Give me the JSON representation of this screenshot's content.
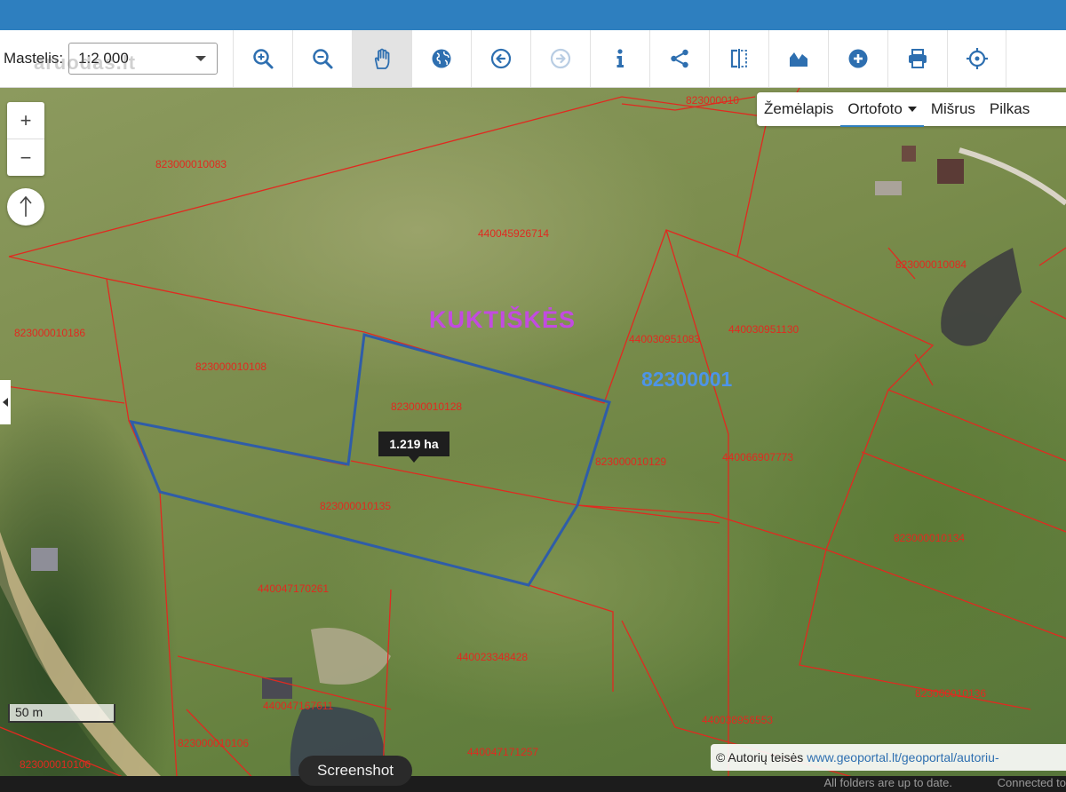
{
  "toolbar": {
    "scale_label": "Mastelis:",
    "scale_value": "1:2 000",
    "watermark": "aruodas.lt",
    "tools": [
      {
        "name": "zoom-in-icon"
      },
      {
        "name": "zoom-out-icon"
      },
      {
        "name": "pan-hand-icon",
        "active": true
      },
      {
        "name": "globe-icon"
      },
      {
        "name": "back-arrow-icon"
      },
      {
        "name": "forward-arrow-icon",
        "disabled": true
      },
      {
        "name": "info-icon"
      },
      {
        "name": "share-icon"
      },
      {
        "name": "split-compare-icon"
      },
      {
        "name": "profile-chart-icon"
      },
      {
        "name": "add-icon"
      },
      {
        "name": "print-icon"
      },
      {
        "name": "locate-icon"
      }
    ]
  },
  "map_controls": {
    "zoom_in": "+",
    "zoom_out": "−",
    "north": "↑"
  },
  "basemap": {
    "options": [
      "Žemėlapis",
      "Ortofoto",
      "Mišrus",
      "Pilkas"
    ],
    "selected": "Ortofoto"
  },
  "map": {
    "place_name": "KUKTIŠKĖS",
    "cadastral_area_code": "82300001",
    "selected_area": "1.219 ha",
    "scale_bar": "50 m",
    "parcels": [
      "823000010083",
      "440045926714",
      "823000010084",
      "823000010186",
      "823000010108",
      "440030951083",
      "440030951130",
      "823000010128",
      "823000010129",
      "440066907773",
      "823000010135",
      "823000010134",
      "440047170261",
      "440023348428",
      "440047167611",
      "440038956553",
      "823000010136",
      "823000010106",
      "440047171257",
      "82300001",
      "823000010"
    ]
  },
  "attribution": {
    "label": "© Autorių teisės",
    "link": "www.geoportal.lt/geoportal/autoriu-"
  },
  "system": {
    "screenshot_button": "Screenshot",
    "status": "All folders are up to date.",
    "connection": "Connected to"
  },
  "colors": {
    "topbar": "#2e7fbf",
    "parcel_line": "#e02a20",
    "selection": "#2f5da8",
    "place_label": "#c24be0",
    "code_label": "#4d94e8"
  }
}
